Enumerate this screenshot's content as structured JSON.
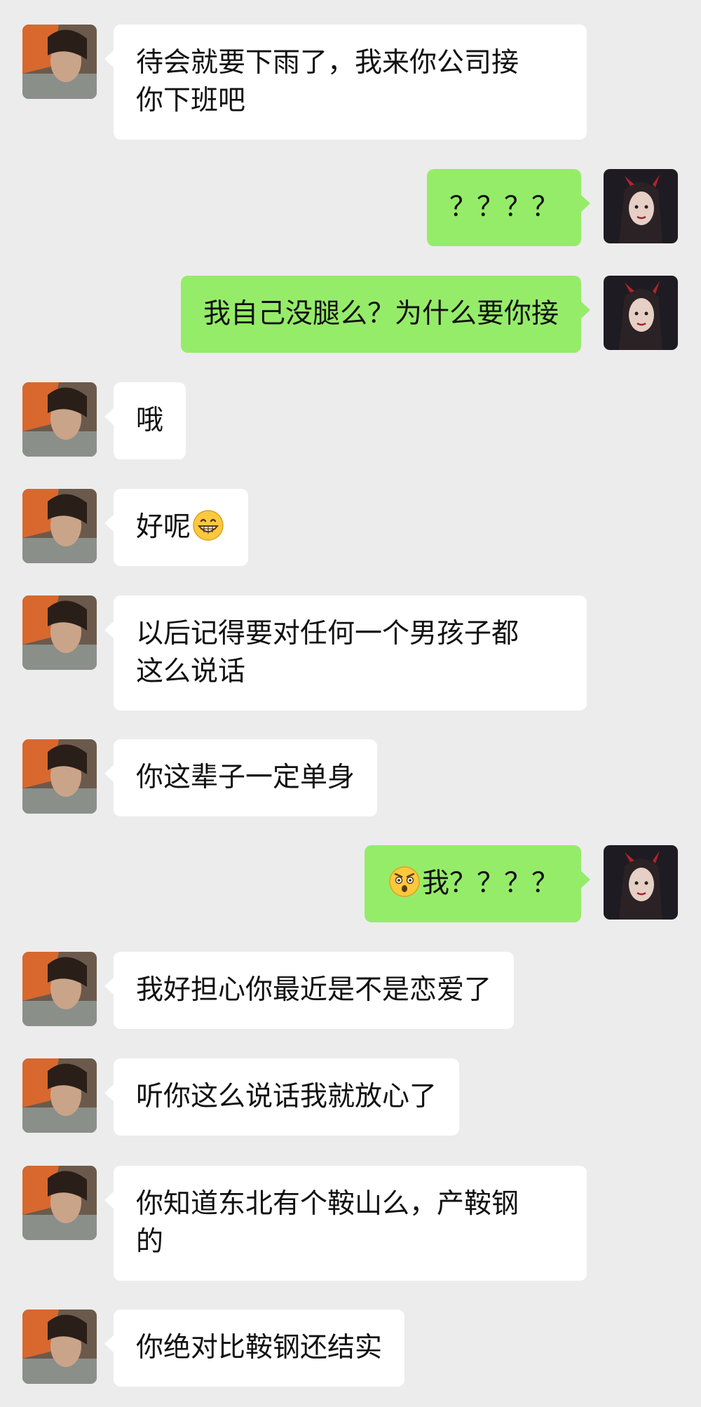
{
  "colors": {
    "background": "#ececec",
    "incoming_bubble": "#ffffff",
    "outgoing_bubble": "#95ec69",
    "text": "#111111"
  },
  "messages": [
    {
      "side": "left",
      "text": "待会就要下雨了，我来你公司接\n你下班吧"
    },
    {
      "side": "right",
      "text": "？？？？"
    },
    {
      "side": "right",
      "text": "我自己没腿么？为什么要你接"
    },
    {
      "side": "left",
      "text": "哦"
    },
    {
      "side": "left",
      "text": "好呢",
      "emoji_after": "grinning-emoji"
    },
    {
      "side": "left",
      "text": "以后记得要对任何一个男孩子都\n这么说话"
    },
    {
      "side": "left",
      "text": "你这辈子一定单身"
    },
    {
      "side": "right",
      "text": "我？？？？",
      "emoji_before": "shocked-emoji"
    },
    {
      "side": "left",
      "text": "我好担心你最近是不是恋爱了"
    },
    {
      "side": "left",
      "text": "听你这么说话我就放心了"
    },
    {
      "side": "left",
      "text": "你知道东北有个鞍山么，产鞍钢\n的"
    },
    {
      "side": "left",
      "text": "你绝对比鞍钢还结实"
    }
  ]
}
